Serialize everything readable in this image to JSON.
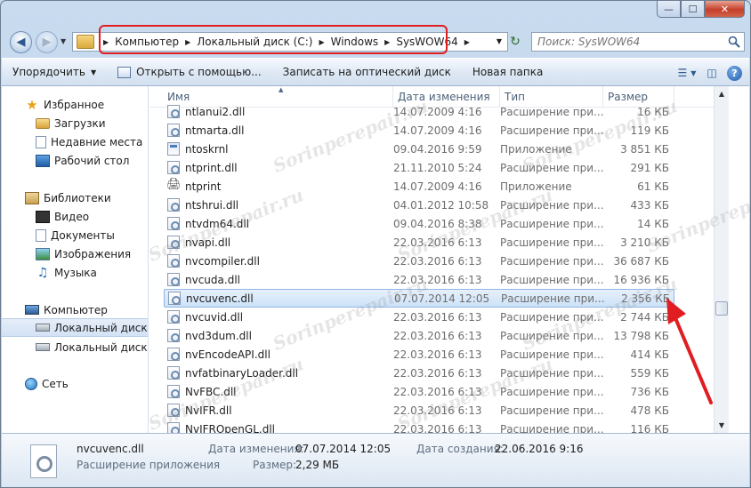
{
  "window": {
    "caption": {
      "minimize": "—",
      "maximize": "☐",
      "close": "✕"
    }
  },
  "nav": {
    "back_icon": "arrow-left",
    "forward_icon": "arrow-right",
    "breadcrumbs": [
      "Компьютер",
      "Локальный диск (C:)",
      "Windows",
      "SysWOW64"
    ],
    "search_placeholder": "Поиск: SysWOW64",
    "highlight_color": "#e01e22"
  },
  "toolbar": {
    "organize": "Упорядочить",
    "open_with": "Открыть с помощью...",
    "burn": "Записать на оптический диск",
    "new_folder": "Новая папка"
  },
  "sidebar": {
    "favorites": "Избранное",
    "downloads": "Загрузки",
    "recent": "Недавние места",
    "desktop": "Рабочий стол",
    "libraries": "Библиотеки",
    "video": "Видео",
    "documents": "Документы",
    "pictures": "Изображения",
    "music": "Музыка",
    "computer": "Компьютер",
    "disk_c": "Локальный диск (C",
    "disk_d": "Локальный диск (D",
    "network": "Сеть"
  },
  "columns": {
    "name": "Имя",
    "date": "Дата изменения",
    "type": "Тип",
    "size": "Размер"
  },
  "files": [
    {
      "name": "ntlanui2.dll",
      "date": "14.07.2009 4:16",
      "type": "Расширение при...",
      "size": "16 КБ",
      "icon": "dll"
    },
    {
      "name": "ntmarta.dll",
      "date": "14.07.2009 4:16",
      "type": "Расширение при...",
      "size": "119 КБ",
      "icon": "dll"
    },
    {
      "name": "ntoskrnl",
      "date": "09.04.2016 9:59",
      "type": "Приложение",
      "size": "3 851 КБ",
      "icon": "exe"
    },
    {
      "name": "ntprint.dll",
      "date": "21.11.2010 5:24",
      "type": "Расширение при...",
      "size": "291 КБ",
      "icon": "dll"
    },
    {
      "name": "ntprint",
      "date": "14.07.2009 4:16",
      "type": "Приложение",
      "size": "61 КБ",
      "icon": "print"
    },
    {
      "name": "ntshrui.dll",
      "date": "04.01.2012 10:58",
      "type": "Расширение при...",
      "size": "433 КБ",
      "icon": "dll"
    },
    {
      "name": "ntvdm64.dll",
      "date": "09.04.2016 8:38",
      "type": "Расширение при...",
      "size": "14 КБ",
      "icon": "dll"
    },
    {
      "name": "nvapi.dll",
      "date": "22.03.2016 6:13",
      "type": "Расширение при...",
      "size": "3 210 КБ",
      "icon": "dll"
    },
    {
      "name": "nvcompiler.dll",
      "date": "22.03.2016 6:13",
      "type": "Расширение при...",
      "size": "36 687 КБ",
      "icon": "dll"
    },
    {
      "name": "nvcuda.dll",
      "date": "22.03.2016 6:13",
      "type": "Расширение при...",
      "size": "16 936 КБ",
      "icon": "dll"
    },
    {
      "name": "nvcuvenc.dll",
      "date": "07.07.2014 12:05",
      "type": "Расширение при...",
      "size": "2 356 КБ",
      "icon": "dll",
      "selected": true
    },
    {
      "name": "nvcuvid.dll",
      "date": "22.03.2016 6:13",
      "type": "Расширение при...",
      "size": "2 744 КБ",
      "icon": "dll"
    },
    {
      "name": "nvd3dum.dll",
      "date": "22.03.2016 6:13",
      "type": "Расширение при...",
      "size": "13 798 КБ",
      "icon": "dll"
    },
    {
      "name": "nvEncodeAPI.dll",
      "date": "22.03.2016 6:13",
      "type": "Расширение при...",
      "size": "414 КБ",
      "icon": "dll"
    },
    {
      "name": "nvfatbinaryLoader.dll",
      "date": "22.03.2016 6:13",
      "type": "Расширение при...",
      "size": "559 КБ",
      "icon": "dll"
    },
    {
      "name": "NvFBC.dll",
      "date": "22.03.2016 6:13",
      "type": "Расширение при...",
      "size": "736 КБ",
      "icon": "dll"
    },
    {
      "name": "NvIFR.dll",
      "date": "22.03.2016 6:13",
      "type": "Расширение при...",
      "size": "478 КБ",
      "icon": "dll"
    },
    {
      "name": "NvIFROpenGL.dll",
      "date": "22.03.2016 6:13",
      "type": "Расширение при...",
      "size": "116 КБ",
      "icon": "dll"
    }
  ],
  "details": {
    "name": "nvcuvenc.dll",
    "type": "Расширение приложения",
    "modified_label": "Дата изменения:",
    "modified_value": "07.07.2014 12:05",
    "size_label": "Размер:",
    "size_value": "2,29 МБ",
    "created_label": "Дата создания:",
    "created_value": "22.06.2016 9:16"
  },
  "watermark": "Sorinperepair.ru"
}
